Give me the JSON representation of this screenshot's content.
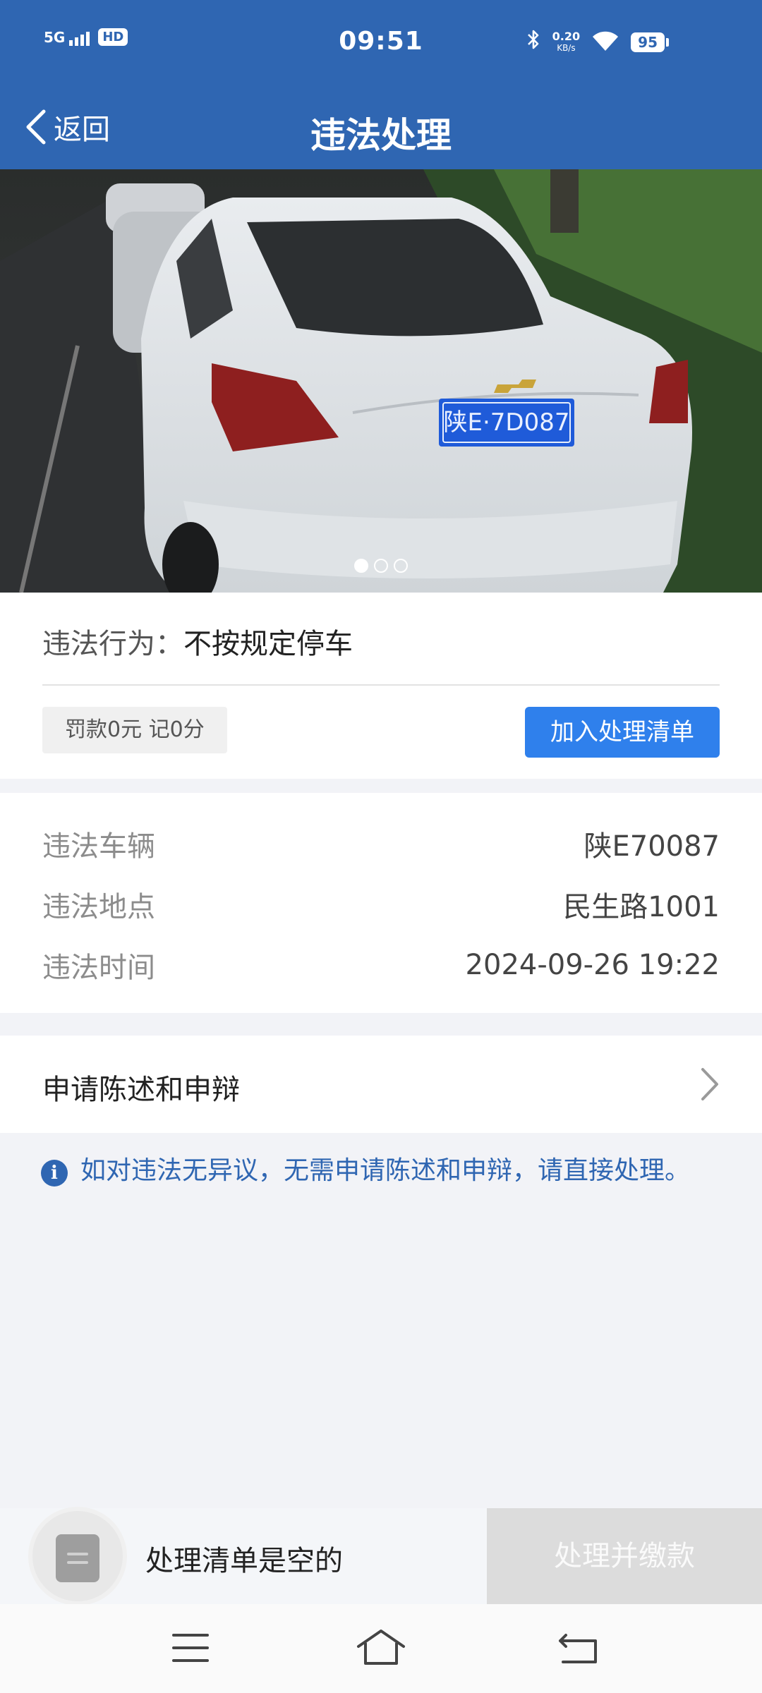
{
  "status_bar": {
    "network": "5G",
    "hd": "HD",
    "time": "09:51",
    "speed_value": "0.20",
    "speed_unit": "KB/s",
    "battery": "95"
  },
  "header": {
    "back_label": "返回",
    "title": "违法处理"
  },
  "photo": {
    "plate_text": "陕E·7D087",
    "page_count": 3,
    "active_index": 0
  },
  "violation": {
    "behavior_label": "违法行为：",
    "behavior_value": "不按规定停车",
    "fine_text": "罚款0元 记0分",
    "add_button": "加入处理清单"
  },
  "details": [
    {
      "label": "违法车辆",
      "value": "陕E70087"
    },
    {
      "label": "违法地点",
      "value": "民生路1001"
    },
    {
      "label": "违法时间",
      "value": "2024-09-26 19:22"
    }
  ],
  "appeal": {
    "label": "申请陈述和申辩"
  },
  "note": {
    "text": "如对违法无异议，无需申请陈述和申辩，请直接处理。"
  },
  "action_bar": {
    "empty_text": "处理清单是空的",
    "pay_button": "处理并缴款"
  },
  "colors": {
    "header_bg": "#2f66b2",
    "primary_button": "#2f80ec",
    "note_text": "#2f66b2",
    "disabled_button": "#dcdcdc"
  },
  "icons": [
    "back-chevron-icon",
    "bluetooth-icon",
    "wifi-icon",
    "battery-icon",
    "chevron-right-icon",
    "info-icon",
    "list-icon",
    "menu-icon",
    "home-icon",
    "back-icon"
  ]
}
